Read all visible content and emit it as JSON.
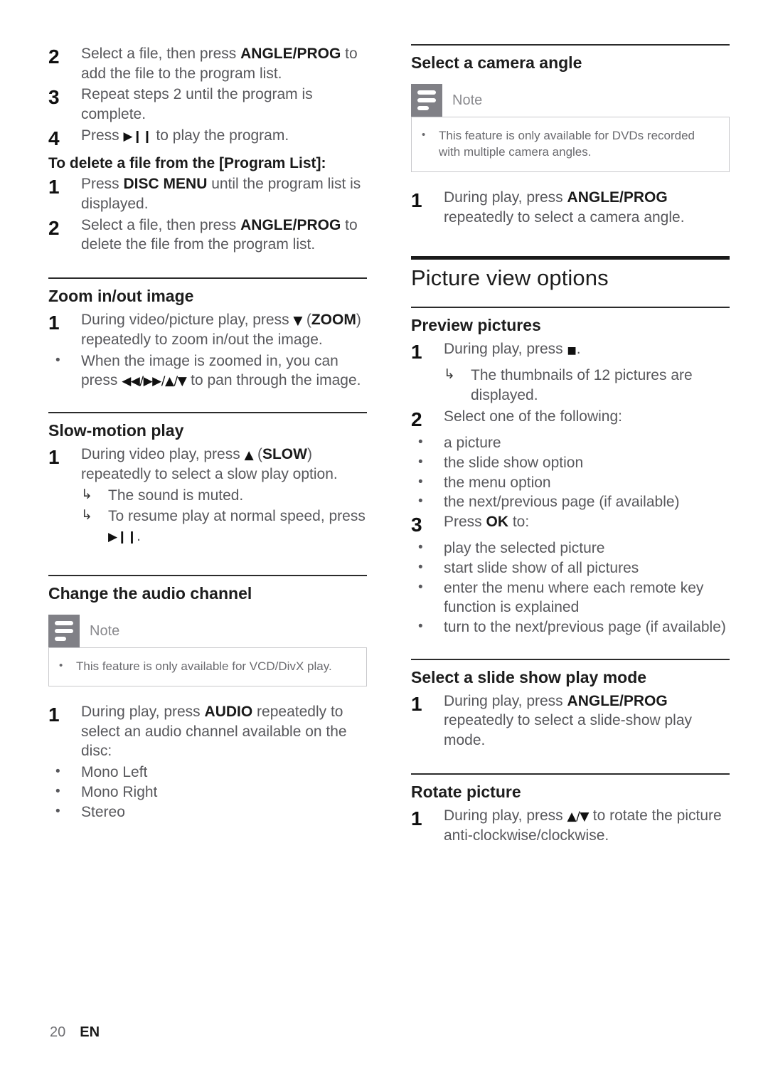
{
  "page": {
    "number": "20",
    "language": "EN"
  },
  "note_label": "Note",
  "glyphs": {
    "play_pause": "▶❙❙",
    "stop": "■",
    "down": "▼",
    "up": "▲",
    "pan": "◀◀/▶▶/▲/▼",
    "up_down": "▲/▼",
    "bullet": "•",
    "result_arrow": "↳"
  },
  "left_column": {
    "program_steps": {
      "step2": {
        "num": "2",
        "text_before": "Select a file, then press ",
        "key": "ANGLE/PROG",
        "text_after": " to add the file to the program list."
      },
      "step3": {
        "num": "3",
        "text": "Repeat steps 2 until the program is complete."
      },
      "step4": {
        "num": "4",
        "text_before": "Press ",
        "text_after": " to play the program."
      }
    },
    "delete_heading": "To delete a file from the [Program List]:",
    "delete_steps": {
      "step1": {
        "num": "1",
        "text_before": "Press ",
        "key": "DISC MENU",
        "text_after": " until the program list is displayed."
      },
      "step2": {
        "num": "2",
        "text_before": "Select a file, then press ",
        "key": "ANGLE/PROG",
        "text_after": " to delete the file from the program list."
      }
    },
    "zoom_section": {
      "title": "Zoom in/out image",
      "step1": {
        "num": "1",
        "text_before": "During video/picture play, press ",
        "text_mid": " (",
        "key": "ZOOM",
        "text_after": ") repeatedly to zoom in/out the image."
      },
      "bullet": {
        "text_before": "When the image is zoomed in, you can press ",
        "text_after": " to pan through the image."
      }
    },
    "slow_section": {
      "title": "Slow-motion play",
      "step1": {
        "num": "1",
        "text_before": "During video play, press ",
        "text_mid": " (",
        "key": "SLOW",
        "text_after": ") repeatedly to select a slow play option."
      },
      "results": {
        "r1": "The sound is muted.",
        "r2_before": "To resume play at normal speed, press ",
        "r2_after": "."
      }
    },
    "audio_section": {
      "title": "Change the audio channel",
      "note": "This feature is only available for VCD/DivX play.",
      "step1": {
        "num": "1",
        "text_before": "During play, press ",
        "key": "AUDIO",
        "text_after": " repeatedly to select an audio channel available on the disc:"
      },
      "options": [
        "Mono Left",
        "Mono Right",
        "Stereo"
      ]
    }
  },
  "right_column": {
    "camera_section": {
      "title": "Select a camera angle",
      "note": "This feature is only available for DVDs recorded with multiple camera angles.",
      "step1": {
        "num": "1",
        "text_before": "During play, press ",
        "key": "ANGLE/PROG",
        "text_after": " repeatedly to select a camera angle."
      }
    },
    "chapter_title": "Picture view options",
    "preview_section": {
      "title": "Preview pictures",
      "step1": {
        "num": "1",
        "text_before": "During play, press ",
        "text_after": "."
      },
      "result": "The thumbnails of 12 pictures are displayed.",
      "step2": {
        "num": "2",
        "text": "Select one of the following:",
        "options": [
          "a picture",
          "the slide show option",
          "the menu option",
          "the next/previous page (if available)"
        ]
      },
      "step3": {
        "num": "3",
        "text_before": "Press ",
        "key": "OK",
        "text_after": " to:",
        "options": [
          "play the selected picture",
          "start slide show of all pictures",
          "enter the menu where each remote key function is explained",
          "turn to the next/previous page (if available)"
        ]
      }
    },
    "slideshow_section": {
      "title": "Select a slide show play mode",
      "step1": {
        "num": "1",
        "text_before": "During play, press ",
        "key": "ANGLE/PROG",
        "text_after": " repeatedly to select a slide-show play mode."
      }
    },
    "rotate_section": {
      "title": "Rotate picture",
      "step1": {
        "num": "1",
        "text_before": "During play, press ",
        "text_after": " to rotate the picture anti-clockwise/clockwise."
      }
    }
  }
}
